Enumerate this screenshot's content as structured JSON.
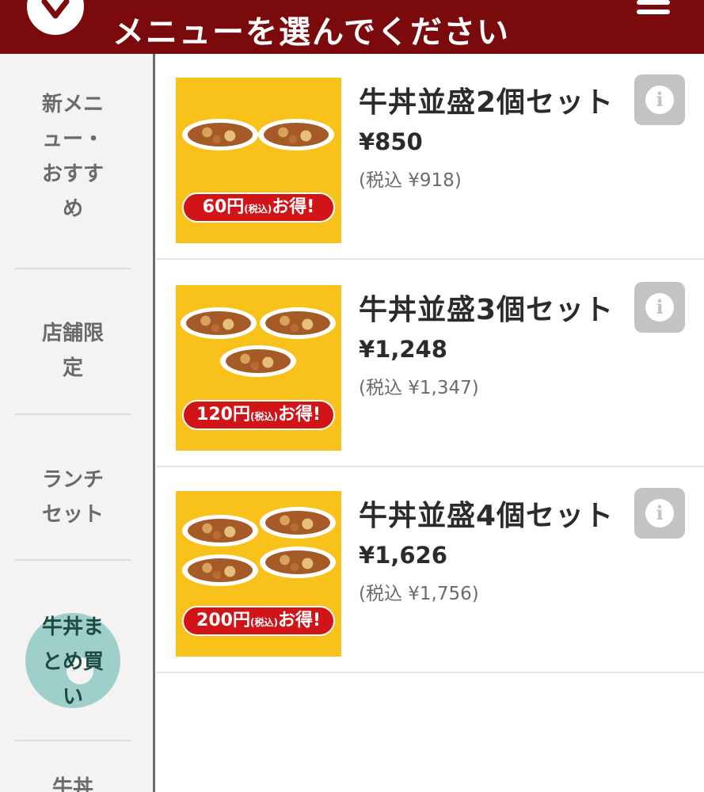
{
  "header": {
    "title": "メニューを選んでください",
    "brand_color": "#7a0a0c"
  },
  "sidebar": {
    "items": [
      {
        "label": "新メニュー・おすすめ",
        "active": false
      },
      {
        "label": "店舗限定",
        "active": false
      },
      {
        "label": "ランチセット",
        "active": false
      },
      {
        "label": "牛丼まとめ買い",
        "active": true
      },
      {
        "label": "牛丼",
        "active": false
      }
    ],
    "active_color": "#9fcfca"
  },
  "products": [
    {
      "name": "牛丼並盛2個セット",
      "price": "¥850",
      "tax_price": "(税込 ¥918)",
      "badge_amount": "60円",
      "badge_tax": "(税込)",
      "badge_deal": "お得!",
      "bowls": 2
    },
    {
      "name": "牛丼並盛3個セット",
      "price": "¥1,248",
      "tax_price": "(税込 ¥1,347)",
      "badge_amount": "120円",
      "badge_tax": "(税込)",
      "badge_deal": "お得!",
      "bowls": 3
    },
    {
      "name": "牛丼並盛4個セット",
      "price": "¥1,626",
      "tax_price": "(税込 ¥1,756)",
      "badge_amount": "200円",
      "badge_tax": "(税込)",
      "badge_deal": "お得!",
      "bowls": 4
    }
  ],
  "icons": {
    "info": "info-icon",
    "menu": "hamburger-menu-icon",
    "logo": "brand-logo"
  }
}
